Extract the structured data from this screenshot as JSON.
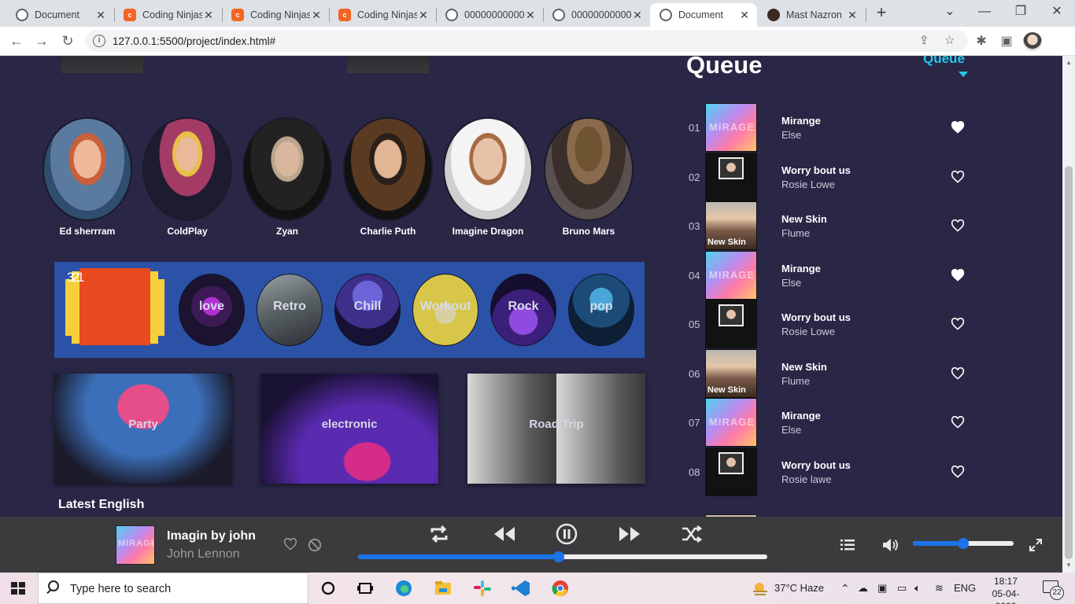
{
  "browser": {
    "tabs": [
      {
        "label": "Document",
        "icon": "globe-icon"
      },
      {
        "label": "Coding Ninjas",
        "icon": "coding-ninjas-icon"
      },
      {
        "label": "Coding Ninjas",
        "icon": "coding-ninjas-icon"
      },
      {
        "label": "Coding Ninjas",
        "icon": "coding-ninjas-icon"
      },
      {
        "label": "000000000000",
        "icon": "globe-icon"
      },
      {
        "label": "000000000000",
        "icon": "globe-icon"
      },
      {
        "label": "Document",
        "icon": "globe-icon",
        "active": true
      },
      {
        "label": "Mast Nazron",
        "icon": "avatar-icon"
      }
    ],
    "url": "127.0.0.1:5500/project/index.html#"
  },
  "artists": [
    {
      "name": "Ed sherrram"
    },
    {
      "name": "ColdPlay"
    },
    {
      "name": "Zyan"
    },
    {
      "name": "Charlie Puth"
    },
    {
      "name": "Imagine Dragon"
    },
    {
      "name": "Bruno Mars"
    }
  ],
  "loader": {
    "digits": "321"
  },
  "genres": [
    {
      "label": "love"
    },
    {
      "label": "Retro"
    },
    {
      "label": "Chill"
    },
    {
      "label": "Workout"
    },
    {
      "label": "Rock"
    },
    {
      "label": "pop"
    }
  ],
  "playlists": [
    {
      "label": "Party"
    },
    {
      "label": "electronic"
    },
    {
      "label": "Road Trip"
    }
  ],
  "section": {
    "latest": "Latest English"
  },
  "queue": {
    "title": "Queue",
    "link": "Queue",
    "items": [
      {
        "num": "01",
        "title": "Mirange",
        "artist": "Else",
        "art": "mirage",
        "liked": true
      },
      {
        "num": "02",
        "title": "Worry bout us",
        "artist": "Rosie Lowe",
        "art": "worry",
        "liked": false
      },
      {
        "num": "03",
        "title": "New Skin",
        "artist": "Flume",
        "art": "skin",
        "liked": false
      },
      {
        "num": "04",
        "title": "Mirange",
        "artist": "Else",
        "art": "mirage",
        "liked": true
      },
      {
        "num": "05",
        "title": "Worry bout us",
        "artist": "Rosie Lowe",
        "art": "worry",
        "liked": false
      },
      {
        "num": "06",
        "title": "New Skin",
        "artist": "Flume",
        "art": "skin",
        "liked": false
      },
      {
        "num": "07",
        "title": "Mirange",
        "artist": "Else",
        "art": "mirage",
        "liked": false
      },
      {
        "num": "08",
        "title": "Worry bout us",
        "artist": "Rosie lawe",
        "art": "worry",
        "liked": false
      }
    ],
    "art_text": {
      "mirage": "MIRAGE",
      "skin": "New Skin"
    }
  },
  "player": {
    "title": "Imagin by john",
    "artist": "John Lennon",
    "progress": 0.49,
    "volume": 0.5
  },
  "taskbar": {
    "search_placeholder": "Type here to search",
    "weather": "37°C  Haze",
    "lang": "ENG",
    "time": "18:17",
    "date": "05-04-2022",
    "notifications": "22"
  },
  "colors": {
    "accent": "#1a73e8",
    "queue_link": "#25c7e6",
    "page_bg": "#2a2646",
    "genre_bg": "#2c52a7"
  }
}
